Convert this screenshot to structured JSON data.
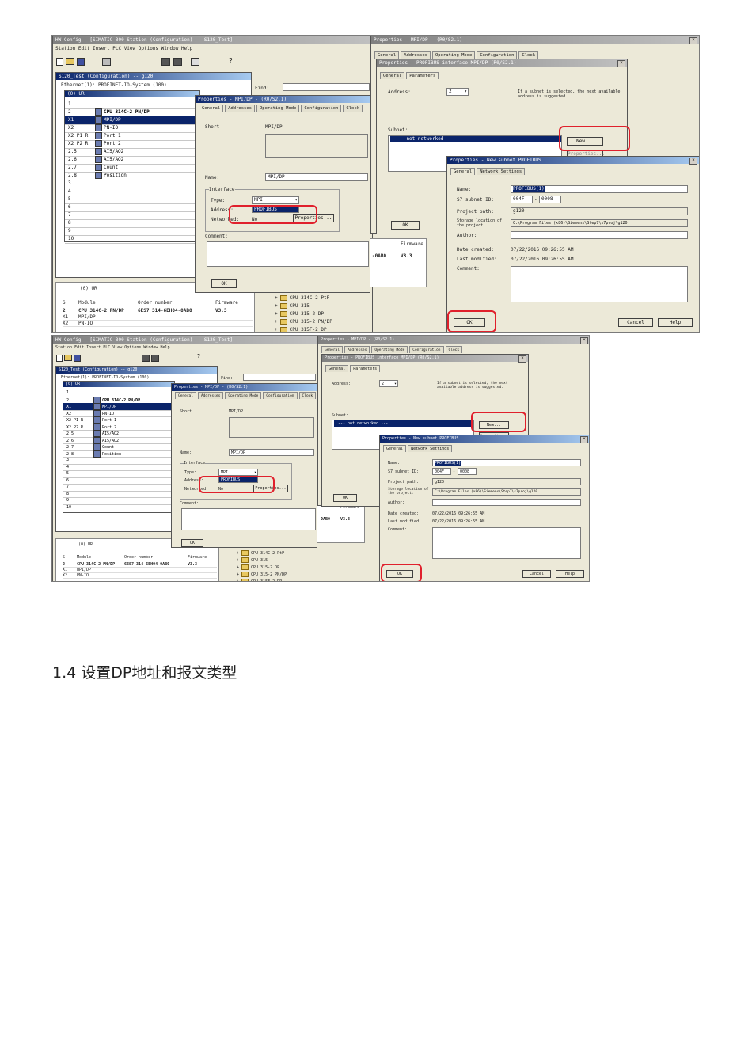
{
  "heading": "1.4 设置DP地址和报文类型",
  "hwconfig": {
    "title": "HW Config - [SIMATIC 300 Station (Configuration) -- S120_Test]",
    "menu": "Station  Edit  Insert  PLC  View  Options  Window  Help",
    "station": "S120_Test (Configuration) -- g120",
    "profibus_label": "Ethernet(1): PROFINET-IO-System (100)",
    "find_label": "Find:",
    "rack_title": "(0) UR",
    "rack_rows": [
      {
        "slot": "1",
        "name": ""
      },
      {
        "slot": "2",
        "name": "CPU 314C-2 PN/DP"
      },
      {
        "slot": "X1",
        "name": "MPI/DP"
      },
      {
        "slot": "X2",
        "name": "PN-IO"
      },
      {
        "slot": "X2 P1 R",
        "name": "Port 1"
      },
      {
        "slot": "X2 P2 R",
        "name": "Port 2"
      },
      {
        "slot": "2.5",
        "name": "AI5/AO2"
      },
      {
        "slot": "2.6",
        "name": "AI5/AO2"
      },
      {
        "slot": "2.7",
        "name": "Count"
      },
      {
        "slot": "2.8",
        "name": "Position"
      },
      {
        "slot": "3",
        "name": ""
      },
      {
        "slot": "4",
        "name": ""
      },
      {
        "slot": "5",
        "name": ""
      },
      {
        "slot": "6",
        "name": ""
      },
      {
        "slot": "7",
        "name": ""
      },
      {
        "slot": "8",
        "name": ""
      },
      {
        "slot": "9",
        "name": ""
      },
      {
        "slot": "10",
        "name": ""
      }
    ],
    "detail_title": "(0) UR",
    "detail_headers": [
      "S",
      "Module",
      "Order number",
      "Firmware"
    ],
    "detail_rows": [
      {
        "slot": "2",
        "module": "CPU 314C-2 PN/DP",
        "order": "6ES7 314-6EH04-0AB0",
        "fw": "V3.3"
      },
      {
        "slot": "X1",
        "module": "MPI/DP",
        "order": "",
        "fw": ""
      },
      {
        "slot": "X2",
        "module": "PN-IO",
        "order": "",
        "fw": ""
      }
    ],
    "catalog": [
      "CPU 314C-2 PtP",
      "CPU 315",
      "CPU 315-2 DP",
      "CPU 315-2 PN/DP",
      "CPU 315F-2 DP"
    ],
    "order_snip": "-0AB0",
    "fw_header": "Firmware",
    "fw_value": "V3.3"
  },
  "props_mpi": {
    "title": "Properties - MPI/DP - (R0/S2.1)",
    "tabs": [
      "General",
      "Addresses",
      "Operating Mode",
      "Configuration",
      "Clock"
    ],
    "short_label": "Short",
    "short_value": "MPI/DP",
    "name_label": "Name:",
    "name_value": "MPI/DP",
    "interface_label": "Interface",
    "type_label": "Type:",
    "type_value": "MPI",
    "address_label": "Address:",
    "dropdown_option": "PROFIBUS",
    "networked_label": "Networked:",
    "networked_value": "No",
    "properties_btn": "Properties...",
    "comment_label": "Comment:",
    "ok": "OK"
  },
  "props_iface": {
    "outer_title": "Properties - MPI/DP - (R0/S2.1)",
    "outer_tabs": [
      "General",
      "Addresses",
      "Operating Mode",
      "Configuration",
      "Clock"
    ],
    "title": "Properties - PROFIBUS interface MPI/DP (R0/S2.1)",
    "tabs": [
      "General",
      "Parameters"
    ],
    "address_label": "Address:",
    "address_value": "2",
    "hint": "If a subnet is selected, the next available address is suggested.",
    "subnet_label": "Subnet:",
    "subnet_item": "--- not networked ---",
    "new_btn": "New...",
    "props_btn": "Properties...",
    "ok": "OK"
  },
  "new_subnet": {
    "title": "Properties - New subnet PROFIBUS",
    "tabs": [
      "General",
      "Network Settings"
    ],
    "name_label": "Name:",
    "name_value": "PROFIBUS(1)",
    "s7id_label": "S7 subnet ID:",
    "s7id_a": "004F",
    "s7id_b": "0008",
    "path_label": "Project path:",
    "path_value": "g120",
    "storage_label": "Storage location of the project:",
    "storage_value": "C:\\Program Files (x86)\\Siemens\\Step7\\s7proj\\g120",
    "author_label": "Author:",
    "created_label": "Date created:",
    "created_value": "07/22/2016 09:26:55 AM",
    "modified_label": "Last modified:",
    "modified_value": "07/22/2016 09:26:55 AM",
    "comment_label": "Comment:",
    "ok": "OK",
    "cancel": "Cancel",
    "help": "Help"
  }
}
